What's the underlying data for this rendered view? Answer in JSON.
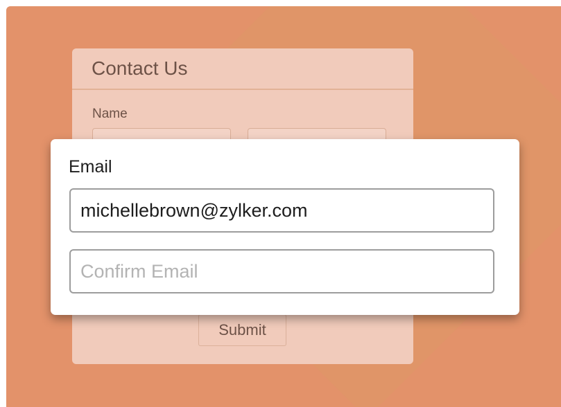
{
  "form": {
    "title": "Contact Us",
    "name_label": "Name",
    "submit_label": "Submit"
  },
  "popup": {
    "email_label": "Email",
    "email_value": "michellebrown@zylker.com",
    "confirm_placeholder": "Confirm Email"
  },
  "colors": {
    "background": "#e3926a",
    "card": "#f1cbbb",
    "text_muted": "#6d5247"
  }
}
